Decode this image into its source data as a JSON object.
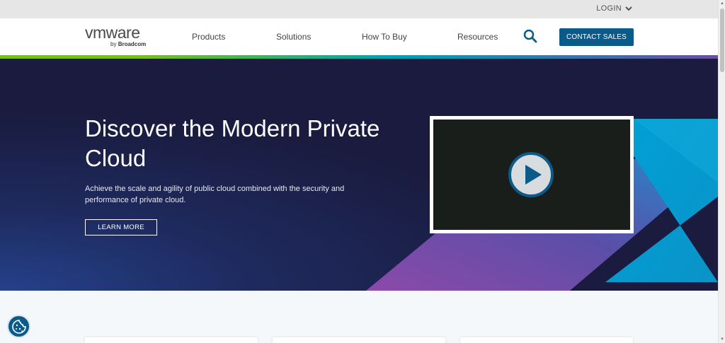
{
  "utility": {
    "login_label": "LOGIN"
  },
  "logo": {
    "main_text": "vmware",
    "sub_prefix": "by",
    "sub_brand": "Broadcom"
  },
  "nav": {
    "items": [
      {
        "label": "Products"
      },
      {
        "label": "Solutions"
      },
      {
        "label": "How To Buy"
      },
      {
        "label": "Resources"
      }
    ],
    "cta_label": "CONTACT SALES"
  },
  "hero": {
    "title": "Discover the Modern Private Cloud",
    "description": "Achieve the scale and agility of public cloud combined with the security and performance of private cloud.",
    "button_label": "LEARN MORE"
  },
  "icons": {
    "search": "search-icon",
    "login_chevron": "chevron-down-icon",
    "play": "play-icon",
    "cookie": "cookie-icon"
  },
  "colors": {
    "brand_blue": "#0a5a8a",
    "hero_bg": "#1a1b3e",
    "accent_cyan": "#00a1d6",
    "accent_green": "#78be20"
  }
}
